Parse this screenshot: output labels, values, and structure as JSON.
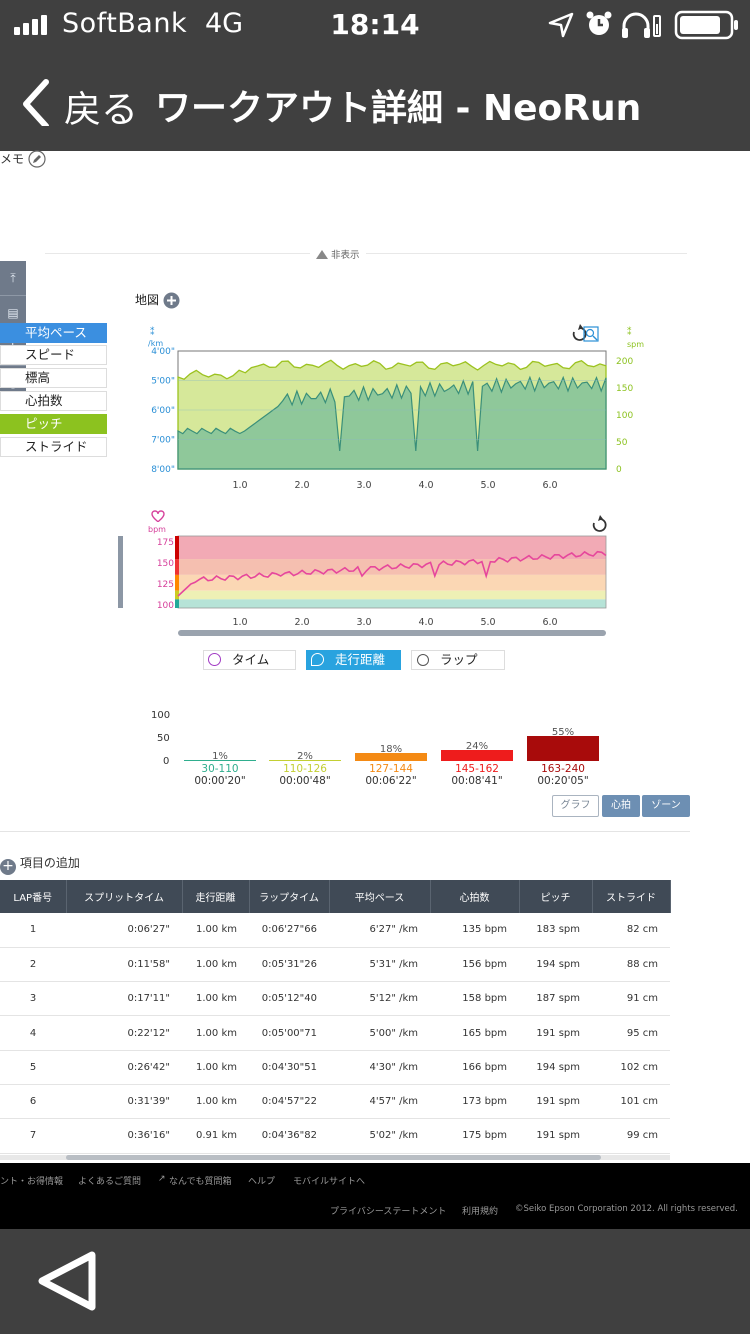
{
  "status": {
    "carrier": "SoftBank",
    "network": "4G",
    "time": "18:14"
  },
  "nav": {
    "back_label": "戻る",
    "title": "ワークアウト詳細 - NeoRun"
  },
  "memo_label": "メモ",
  "hide_label": "非表示",
  "map_label": "地図",
  "legend": {
    "items": [
      {
        "label": "平均ペース",
        "active": true,
        "color": "#3b8fe0"
      },
      {
        "label": "スピード",
        "active": false
      },
      {
        "label": "標高",
        "active": false
      },
      {
        "label": "心拍数",
        "active": false
      },
      {
        "label": "ピッチ",
        "active": true,
        "color": "#8cc21f"
      },
      {
        "label": "ストライド",
        "active": false
      }
    ]
  },
  "chart1": {
    "left_unit_top": "/km",
    "right_unit": "spm",
    "left_ticks": [
      "4'00\"",
      "5'00\"",
      "6'00\"",
      "7'00\"",
      "8'00\""
    ],
    "right_ticks": [
      "200",
      "150",
      "100",
      "50",
      "0"
    ],
    "x_ticks": [
      "1.0",
      "2.0",
      "3.0",
      "4.0",
      "5.0",
      "6.0"
    ]
  },
  "chart2": {
    "unit": "bpm",
    "y_ticks": [
      "175",
      "150",
      "125",
      "100"
    ],
    "x_ticks": [
      "1.0",
      "2.0",
      "3.0",
      "4.0",
      "5.0",
      "6.0"
    ]
  },
  "tabs": {
    "time": "タイム",
    "distance": "走行距離",
    "lap": "ラップ"
  },
  "zones": {
    "y_ticks": [
      "100",
      "50",
      "0"
    ],
    "items": [
      {
        "pct": "1%",
        "range": "30-110",
        "time": "00:00'20\"",
        "value": 1,
        "color": "#2fae8e"
      },
      {
        "pct": "2%",
        "range": "110-126",
        "time": "00:00'48\"",
        "value": 2,
        "color": "#c3cf33"
      },
      {
        "pct": "18%",
        "range": "127-144",
        "time": "00:06'22\"",
        "value": 18,
        "color": "#f48a14"
      },
      {
        "pct": "24%",
        "range": "145-162",
        "time": "00:08'41\"",
        "value": 24,
        "color": "#ee1c1c"
      },
      {
        "pct": "55%",
        "range": "163-240",
        "time": "00:20'05\"",
        "value": 55,
        "color": "#a80b0b"
      }
    ]
  },
  "view_buttons": {
    "graph": "グラフ",
    "heart": "心拍",
    "zone": "ゾーン"
  },
  "add_items_label": "項目の追加",
  "table": {
    "headers": [
      "LAP番号",
      "スプリットタイム",
      "走行距離",
      "ラップタイム",
      "平均ペース",
      "心拍数",
      "ピッチ",
      "ストライド"
    ],
    "rows": [
      [
        "1",
        "0:06'27\"",
        "1.00 km",
        "0:06'27\"66",
        "6'27\" /km",
        "135 bpm",
        "183 spm",
        "82 cm"
      ],
      [
        "2",
        "0:11'58\"",
        "1.00 km",
        "0:05'31\"26",
        "5'31\" /km",
        "156 bpm",
        "194 spm",
        "88 cm"
      ],
      [
        "3",
        "0:17'11\"",
        "1.00 km",
        "0:05'12\"40",
        "5'12\" /km",
        "158 bpm",
        "187 spm",
        "91 cm"
      ],
      [
        "4",
        "0:22'12\"",
        "1.00 km",
        "0:05'00\"71",
        "5'00\" /km",
        "165 bpm",
        "191 spm",
        "95 cm"
      ],
      [
        "5",
        "0:26'42\"",
        "1.00 km",
        "0:04'30\"51",
        "4'30\" /km",
        "166 bpm",
        "194 spm",
        "102 cm"
      ],
      [
        "6",
        "0:31'39\"",
        "1.00 km",
        "0:04'57\"22",
        "4'57\" /km",
        "173 bpm",
        "191 spm",
        "101 cm"
      ],
      [
        "7",
        "0:36'16\"",
        "0.91 km",
        "0:04'36\"82",
        "5'02\" /km",
        "175 bpm",
        "191 spm",
        "99 cm"
      ]
    ]
  },
  "footer": {
    "links": [
      "ント・お得情報",
      "よくあるご質問",
      "なんでも質問箱",
      "ヘルプ",
      "モバイルサイトへ"
    ],
    "privacy": "プライバシーステートメント",
    "terms": "利用規約",
    "copyright": "©Seiko Epson Corporation 2012. All rights reserved."
  }
}
